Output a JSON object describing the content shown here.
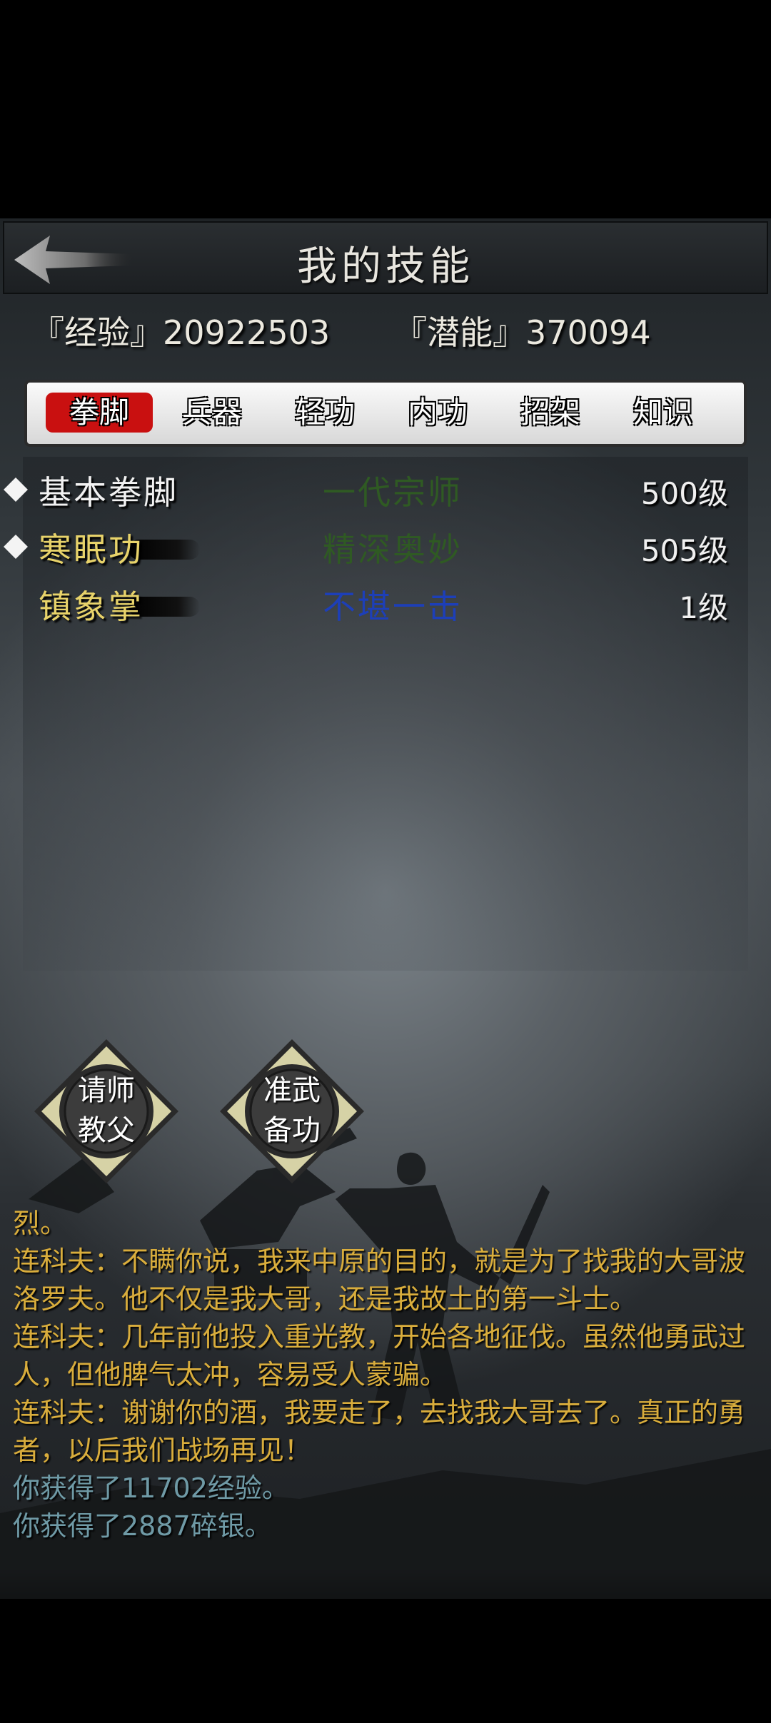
{
  "header": {
    "title": "我的技能",
    "back_icon": "back-arrow-icon"
  },
  "stats": {
    "experience": "『经验』20922503",
    "potential": "『潜能』370094"
  },
  "tabs": [
    {
      "label": "拳脚",
      "active": true
    },
    {
      "label": "兵器",
      "active": false
    },
    {
      "label": "轻功",
      "active": false
    },
    {
      "label": "内功",
      "active": false
    },
    {
      "label": "招架",
      "active": false
    },
    {
      "label": "知识",
      "active": false
    }
  ],
  "skills": [
    {
      "name": "基本拳脚",
      "grade": "一代宗师",
      "level": "500级",
      "name_color": "#f2f2f2",
      "grade_color": "#2f5a23",
      "bullet": true
    },
    {
      "name": "寒眠功",
      "grade": "精深奥妙",
      "level": "505级",
      "name_color": "#e8d36a",
      "grade_color": "#2f5a23",
      "bullet": true
    },
    {
      "name": "镇象掌",
      "grade": "不堪一击",
      "level": "1级",
      "name_color": "#e8d36a",
      "grade_color": "#1d3fb8",
      "bullet": false
    }
  ],
  "buttons": {
    "teacher": {
      "line1": "请师",
      "line2": "教父"
    },
    "prepare": {
      "line1": "准武",
      "line2": "备功"
    }
  },
  "log": [
    {
      "text": "烈。",
      "kind": "npc"
    },
    {
      "text": "连科夫：不瞒你说，我来中原的目的，就是为了找我的大哥波洛罗夫。他不仅是我大哥，还是我故土的第一斗士。",
      "kind": "npc"
    },
    {
      "text": "连科夫：几年前他投入重光教，开始各地征伐。虽然他勇武过人，但他脾气太冲，容易受人蒙骗。",
      "kind": "npc"
    },
    {
      "text": "连科夫：谢谢你的酒，我要走了，去找我大哥去了。真正的勇者，以后我们战场再见！",
      "kind": "npc"
    },
    {
      "text": "你获得了11702经验。",
      "kind": "sys"
    },
    {
      "text": "你获得了2887碎银。",
      "kind": "sys"
    }
  ],
  "colors": {
    "npc_text": "#d9ad3c",
    "system_text": "#6f9aa6",
    "active_tab": "#c91010"
  }
}
